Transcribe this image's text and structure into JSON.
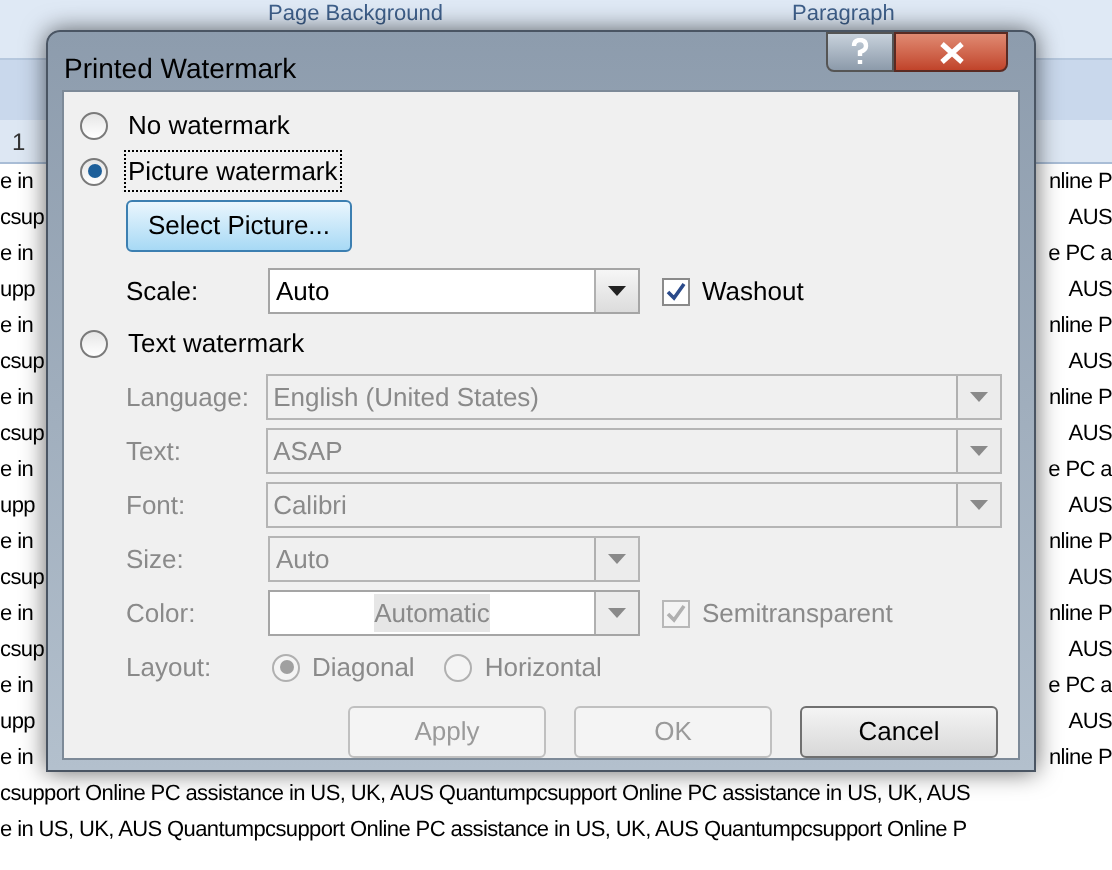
{
  "ribbon": {
    "groups": [
      "Page Background",
      "Paragraph"
    ]
  },
  "ruler": {
    "mark": "1"
  },
  "document": {
    "lines": [
      {
        "left": "e in",
        "right": "nline P"
      },
      {
        "left": "csup",
        "right": "AUS"
      },
      {
        "left": "e in",
        "right": "e PC a"
      },
      {
        "left": "upp",
        "right": "AUS"
      },
      {
        "left": "e in",
        "right": "nline P"
      },
      {
        "left": "csup",
        "right": "AUS"
      },
      {
        "left": "e in",
        "right": "nline P"
      },
      {
        "left": "csup",
        "right": "AUS"
      },
      {
        "left": "e in",
        "right": "e PC a"
      },
      {
        "left": "upp",
        "right": "AUS"
      },
      {
        "left": "e in",
        "right": "nline P"
      },
      {
        "left": "csup",
        "right": "AUS"
      },
      {
        "left": "e in",
        "right": "nline P"
      },
      {
        "left": "csup",
        "right": "AUS"
      },
      {
        "left": "e in",
        "right": "e PC a"
      },
      {
        "left": "upp",
        "right": "AUS"
      },
      {
        "left": "e in",
        "right": "nline P"
      }
    ],
    "full_lines": [
      "csupport Online PC assistance in US, UK, AUS  Quantumpcsupport Online PC assistance in US, UK, AUS",
      "e in US, UK, AUS Quantumpcsupport Online PC assistance in US, UK, AUS  Quantumpcsupport Online P"
    ]
  },
  "dialog": {
    "title": "Printed Watermark",
    "options": [
      {
        "kind": "none",
        "label": "No watermark",
        "selected": false,
        "focused": false
      },
      {
        "kind": "picture",
        "label": "Picture watermark",
        "selected": true,
        "focused": true
      },
      {
        "kind": "text",
        "label": "Text watermark",
        "selected": false,
        "focused": false
      }
    ],
    "picture": {
      "button": "Select Picture...",
      "scale_label": "Scale:",
      "scale": "Auto",
      "washout": {
        "label": "Washout",
        "checked": true
      }
    },
    "text": {
      "disabled": true,
      "fields": [
        {
          "kind": "long",
          "label": "Language:",
          "value": "English (United States)"
        },
        {
          "kind": "long",
          "label": "Text:",
          "value": "ASAP"
        },
        {
          "kind": "long",
          "label": "Font:",
          "value": "Calibri"
        },
        {
          "kind": "short",
          "label": "Size:",
          "value": "Auto"
        },
        {
          "kind": "color",
          "label": "Color:",
          "value": "Automatic"
        }
      ],
      "semitransparent": {
        "label": "Semitransparent",
        "checked": true
      },
      "layout": {
        "label": "Layout:",
        "options": [
          {
            "label": "Diagonal",
            "selected": true
          },
          {
            "label": "Horizontal",
            "selected": false
          }
        ]
      }
    },
    "buttons": [
      {
        "label": "Apply",
        "disabled": true
      },
      {
        "label": "OK",
        "disabled": true
      },
      {
        "label": "Cancel",
        "disabled": false
      }
    ]
  }
}
